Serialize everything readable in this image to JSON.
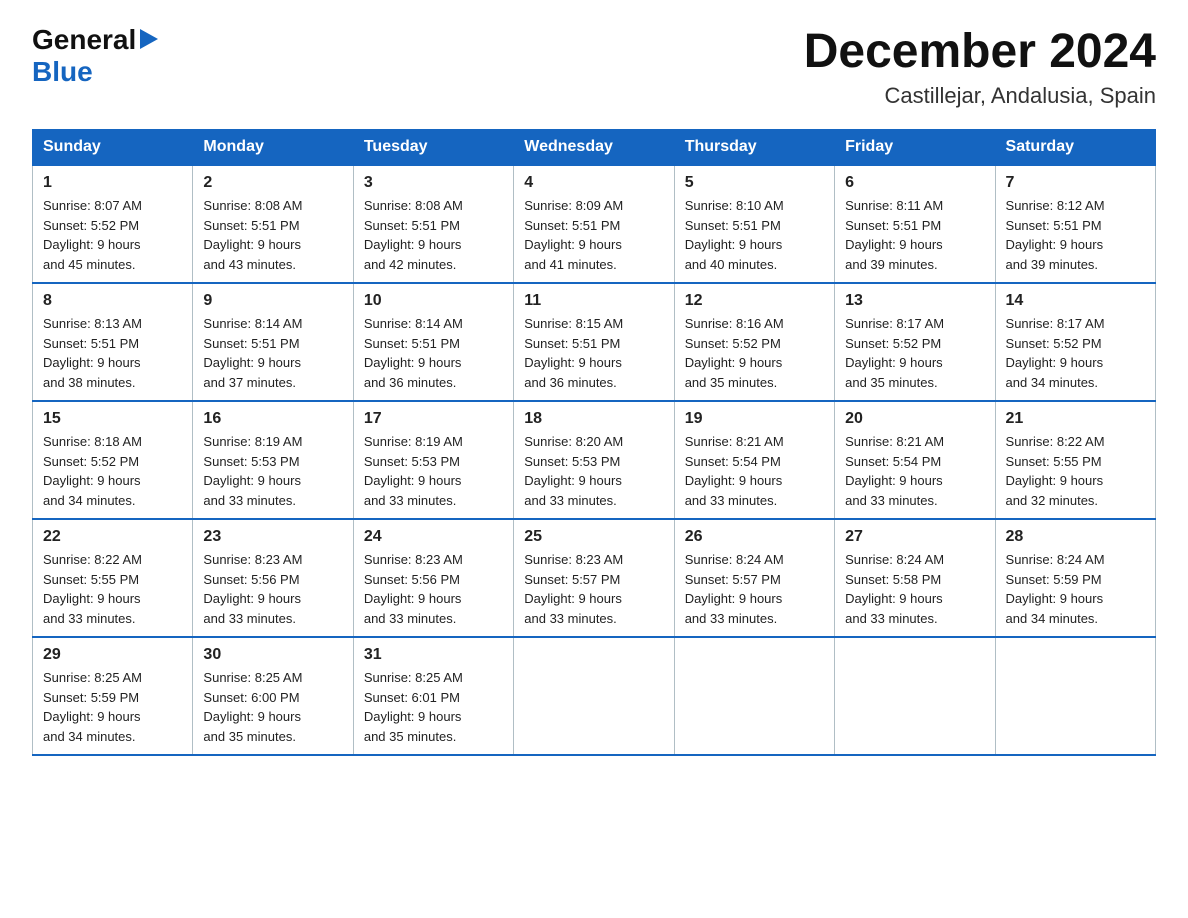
{
  "logo": {
    "general": "General",
    "blue": "Blue",
    "arrow": "▶"
  },
  "title": "December 2024",
  "location": "Castillejar, Andalusia, Spain",
  "headers": [
    "Sunday",
    "Monday",
    "Tuesday",
    "Wednesday",
    "Thursday",
    "Friday",
    "Saturday"
  ],
  "weeks": [
    [
      {
        "day": "1",
        "sunrise": "8:07 AM",
        "sunset": "5:52 PM",
        "daylight": "9 hours and 45 minutes."
      },
      {
        "day": "2",
        "sunrise": "8:08 AM",
        "sunset": "5:51 PM",
        "daylight": "9 hours and 43 minutes."
      },
      {
        "day": "3",
        "sunrise": "8:08 AM",
        "sunset": "5:51 PM",
        "daylight": "9 hours and 42 minutes."
      },
      {
        "day": "4",
        "sunrise": "8:09 AM",
        "sunset": "5:51 PM",
        "daylight": "9 hours and 41 minutes."
      },
      {
        "day": "5",
        "sunrise": "8:10 AM",
        "sunset": "5:51 PM",
        "daylight": "9 hours and 40 minutes."
      },
      {
        "day": "6",
        "sunrise": "8:11 AM",
        "sunset": "5:51 PM",
        "daylight": "9 hours and 39 minutes."
      },
      {
        "day": "7",
        "sunrise": "8:12 AM",
        "sunset": "5:51 PM",
        "daylight": "9 hours and 39 minutes."
      }
    ],
    [
      {
        "day": "8",
        "sunrise": "8:13 AM",
        "sunset": "5:51 PM",
        "daylight": "9 hours and 38 minutes."
      },
      {
        "day": "9",
        "sunrise": "8:14 AM",
        "sunset": "5:51 PM",
        "daylight": "9 hours and 37 minutes."
      },
      {
        "day": "10",
        "sunrise": "8:14 AM",
        "sunset": "5:51 PM",
        "daylight": "9 hours and 36 minutes."
      },
      {
        "day": "11",
        "sunrise": "8:15 AM",
        "sunset": "5:51 PM",
        "daylight": "9 hours and 36 minutes."
      },
      {
        "day": "12",
        "sunrise": "8:16 AM",
        "sunset": "5:52 PM",
        "daylight": "9 hours and 35 minutes."
      },
      {
        "day": "13",
        "sunrise": "8:17 AM",
        "sunset": "5:52 PM",
        "daylight": "9 hours and 35 minutes."
      },
      {
        "day": "14",
        "sunrise": "8:17 AM",
        "sunset": "5:52 PM",
        "daylight": "9 hours and 34 minutes."
      }
    ],
    [
      {
        "day": "15",
        "sunrise": "8:18 AM",
        "sunset": "5:52 PM",
        "daylight": "9 hours and 34 minutes."
      },
      {
        "day": "16",
        "sunrise": "8:19 AM",
        "sunset": "5:53 PM",
        "daylight": "9 hours and 33 minutes."
      },
      {
        "day": "17",
        "sunrise": "8:19 AM",
        "sunset": "5:53 PM",
        "daylight": "9 hours and 33 minutes."
      },
      {
        "day": "18",
        "sunrise": "8:20 AM",
        "sunset": "5:53 PM",
        "daylight": "9 hours and 33 minutes."
      },
      {
        "day": "19",
        "sunrise": "8:21 AM",
        "sunset": "5:54 PM",
        "daylight": "9 hours and 33 minutes."
      },
      {
        "day": "20",
        "sunrise": "8:21 AM",
        "sunset": "5:54 PM",
        "daylight": "9 hours and 33 minutes."
      },
      {
        "day": "21",
        "sunrise": "8:22 AM",
        "sunset": "5:55 PM",
        "daylight": "9 hours and 32 minutes."
      }
    ],
    [
      {
        "day": "22",
        "sunrise": "8:22 AM",
        "sunset": "5:55 PM",
        "daylight": "9 hours and 33 minutes."
      },
      {
        "day": "23",
        "sunrise": "8:23 AM",
        "sunset": "5:56 PM",
        "daylight": "9 hours and 33 minutes."
      },
      {
        "day": "24",
        "sunrise": "8:23 AM",
        "sunset": "5:56 PM",
        "daylight": "9 hours and 33 minutes."
      },
      {
        "day": "25",
        "sunrise": "8:23 AM",
        "sunset": "5:57 PM",
        "daylight": "9 hours and 33 minutes."
      },
      {
        "day": "26",
        "sunrise": "8:24 AM",
        "sunset": "5:57 PM",
        "daylight": "9 hours and 33 minutes."
      },
      {
        "day": "27",
        "sunrise": "8:24 AM",
        "sunset": "5:58 PM",
        "daylight": "9 hours and 33 minutes."
      },
      {
        "day": "28",
        "sunrise": "8:24 AM",
        "sunset": "5:59 PM",
        "daylight": "9 hours and 34 minutes."
      }
    ],
    [
      {
        "day": "29",
        "sunrise": "8:25 AM",
        "sunset": "5:59 PM",
        "daylight": "9 hours and 34 minutes."
      },
      {
        "day": "30",
        "sunrise": "8:25 AM",
        "sunset": "6:00 PM",
        "daylight": "9 hours and 35 minutes."
      },
      {
        "day": "31",
        "sunrise": "8:25 AM",
        "sunset": "6:01 PM",
        "daylight": "9 hours and 35 minutes."
      },
      null,
      null,
      null,
      null
    ]
  ]
}
